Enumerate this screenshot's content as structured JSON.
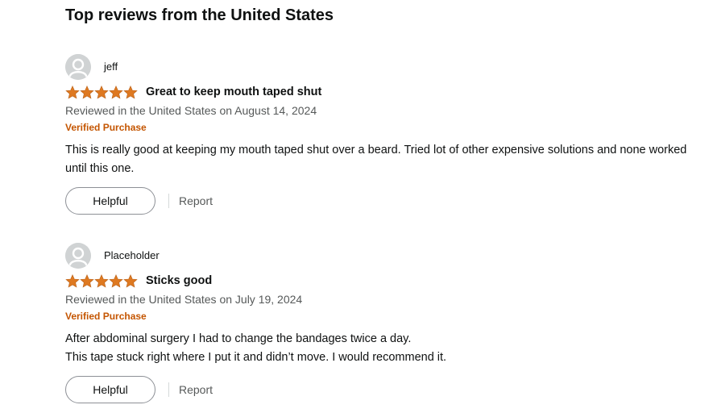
{
  "section": {
    "title": "Top reviews from the United States"
  },
  "colors": {
    "star": "#de7921",
    "verified": "#c45500",
    "meta_text": "#565959",
    "avatar_bg": "#d0d3d4"
  },
  "reviews": [
    {
      "author": "jeff",
      "avatar_icon": "default-user-avatar-icon",
      "rating": 5,
      "rating_max": 5,
      "title": "Great to keep mouth taped shut",
      "date_line": "Reviewed in the United States on August 14, 2024",
      "verified_label": "Verified Purchase",
      "body": [
        "This is really good at keeping my mouth taped shut over a beard. Tried lot of other expensive solutions and none worked until this one."
      ],
      "helpful_label": "Helpful",
      "report_label": "Report"
    },
    {
      "author": "Placeholder",
      "avatar_icon": "default-user-avatar-icon",
      "rating": 5,
      "rating_max": 5,
      "title": "Sticks good",
      "date_line": "Reviewed in the United States on July 19, 2024",
      "verified_label": "Verified Purchase",
      "body": [
        "After abdominal surgery I had to change the bandages twice a day.",
        "This tape stuck right where I put it and didn’t move. I would recommend it."
      ],
      "helpful_label": "Helpful",
      "report_label": "Report"
    }
  ]
}
